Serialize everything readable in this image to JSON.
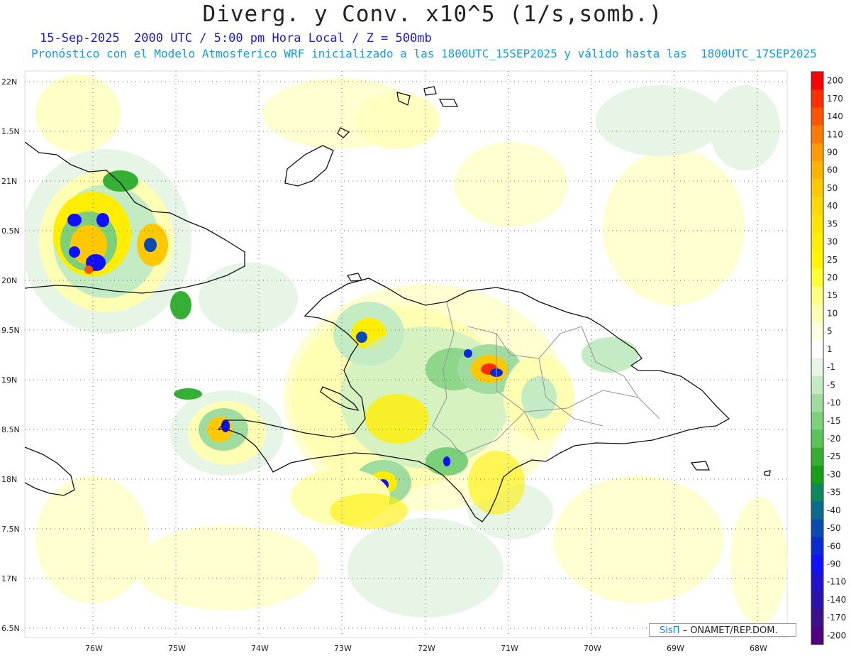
{
  "header": {
    "title": "Diverg. y Conv. x10^5 (1/s,somb.)",
    "line1": "15-Sep-2025  2000 UTC / 5:00 pm Hora Local / Z = 500mb",
    "line2": "Pronóstico con el Modelo Atmosferico WRF inicializado a las 1800UTC_15SEP2025 y válido hasta las  1800UTC_17SEP2025"
  },
  "axes": {
    "lat_labels": [
      "22N",
      "1.5N",
      "21N",
      "0.5N",
      "20N",
      "9.5N",
      "19N",
      "8.5N",
      "18N",
      "7.5N",
      "17N",
      "6.5N"
    ],
    "lon_labels": [
      "76W",
      "75W",
      "74W",
      "73W",
      "72W",
      "71W",
      "70W",
      "69W",
      "68W"
    ]
  },
  "colorbar": {
    "labels": [
      "200",
      "170",
      "140",
      "110",
      "90",
      "60",
      "50",
      "40",
      "35",
      "30",
      "25",
      "20",
      "15",
      "10",
      "5",
      "1",
      "-1",
      "-5",
      "-10",
      "-15",
      "-20",
      "-25",
      "-30",
      "-35",
      "-40",
      "-50",
      "-60",
      "-90",
      "-110",
      "-140",
      "-170",
      "-200"
    ],
    "colors": [
      "#ff0000",
      "#ff2e00",
      "#ff5500",
      "#ff7a00",
      "#ff9a00",
      "#ffb400",
      "#ffc800",
      "#ffd800",
      "#ffe400",
      "#ffee00",
      "#fff600",
      "#ffff33",
      "#ffff80",
      "#ffffb4",
      "#ffffe0",
      "#ffffff",
      "#e6f5e6",
      "#c4ecc4",
      "#a0dca0",
      "#7cd07c",
      "#5ac45a",
      "#34b034",
      "#16a016",
      "#0a8a5a",
      "#0a6c8c",
      "#0a4ab4",
      "#0a2ad8",
      "#1010ff",
      "#2010d0",
      "#2a10b0",
      "#3a1090",
      "#500080"
    ]
  },
  "credit": {
    "logo": "SisΠ",
    "org": "– ONAMET/REP.DOM."
  }
}
